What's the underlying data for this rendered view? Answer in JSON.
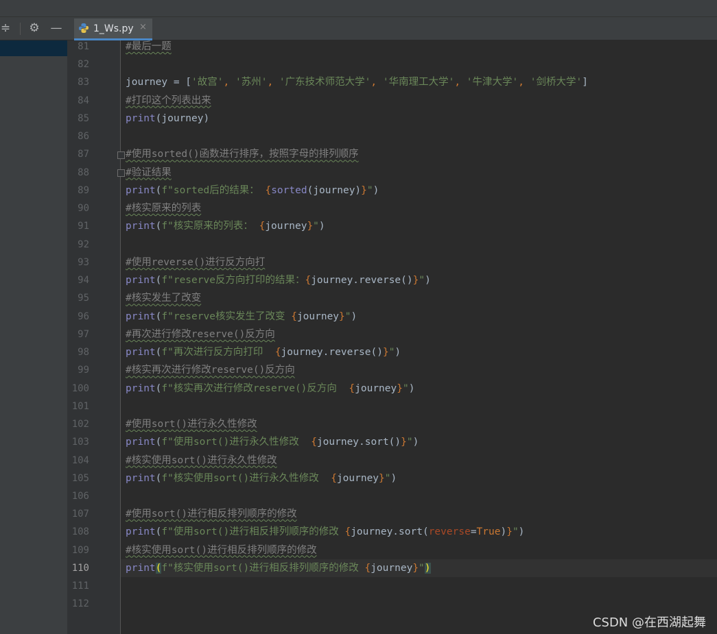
{
  "tab": {
    "label": "1_Ws.py",
    "close": "×"
  },
  "toolbar": {
    "collapse_icon": "≑",
    "settings_icon": "⚙",
    "minimize_icon": "—"
  },
  "watermark": "CSDN @在西湖起舞",
  "lines": [
    {
      "num": "81",
      "tokens": [
        {
          "t": "#最后一题",
          "c": "cm"
        }
      ]
    },
    {
      "num": "82",
      "tokens": []
    },
    {
      "num": "83",
      "tokens": [
        {
          "t": "journey = [",
          "c": "plain"
        },
        {
          "t": "'故宫'",
          "c": "str"
        },
        {
          "t": ", ",
          "c": "brace"
        },
        {
          "t": "'苏州'",
          "c": "str"
        },
        {
          "t": ", ",
          "c": "brace"
        },
        {
          "t": "'广东技术师范大学'",
          "c": "str"
        },
        {
          "t": ", ",
          "c": "brace"
        },
        {
          "t": "'华南理工大学'",
          "c": "str"
        },
        {
          "t": ", ",
          "c": "brace"
        },
        {
          "t": "'牛津大学'",
          "c": "str"
        },
        {
          "t": ", ",
          "c": "brace"
        },
        {
          "t": "'剑桥大学'",
          "c": "str"
        },
        {
          "t": "]",
          "c": "plain"
        }
      ]
    },
    {
      "num": "84",
      "tokens": [
        {
          "t": "#打印这个列表出来",
          "c": "cm"
        }
      ]
    },
    {
      "num": "85",
      "tokens": [
        {
          "t": "print",
          "c": "kw"
        },
        {
          "t": "(journey)",
          "c": "plain"
        }
      ]
    },
    {
      "num": "86",
      "tokens": []
    },
    {
      "num": "87",
      "tokens": [
        {
          "t": "#使用sorted()函数进行排序，按照字母的排列顺序",
          "c": "cm"
        }
      ]
    },
    {
      "num": "88",
      "tokens": [
        {
          "t": "#验证结果",
          "c": "cm"
        }
      ]
    },
    {
      "num": "89",
      "tokens": [
        {
          "t": "print",
          "c": "kw"
        },
        {
          "t": "(",
          "c": "plain"
        },
        {
          "t": "f\"sorted后的结果： ",
          "c": "str"
        },
        {
          "t": "{",
          "c": "brace"
        },
        {
          "t": "sorted",
          "c": "kw"
        },
        {
          "t": "(journey)",
          "c": "plain"
        },
        {
          "t": "}",
          "c": "brace"
        },
        {
          "t": "\"",
          "c": "str"
        },
        {
          "t": ")",
          "c": "plain"
        }
      ]
    },
    {
      "num": "90",
      "tokens": [
        {
          "t": "#核实原来的列表",
          "c": "cm"
        }
      ]
    },
    {
      "num": "91",
      "tokens": [
        {
          "t": "print",
          "c": "kw"
        },
        {
          "t": "(",
          "c": "plain"
        },
        {
          "t": "f\"核实原来的列表： ",
          "c": "str"
        },
        {
          "t": "{",
          "c": "brace"
        },
        {
          "t": "journey",
          "c": "plain"
        },
        {
          "t": "}",
          "c": "brace"
        },
        {
          "t": "\"",
          "c": "str"
        },
        {
          "t": ")",
          "c": "plain"
        }
      ]
    },
    {
      "num": "92",
      "tokens": []
    },
    {
      "num": "93",
      "tokens": [
        {
          "t": "#使用reverse()进行反方向打",
          "c": "cm"
        }
      ]
    },
    {
      "num": "94",
      "tokens": [
        {
          "t": "print",
          "c": "kw"
        },
        {
          "t": "(",
          "c": "plain"
        },
        {
          "t": "f\"reserve反方向打印的结果：",
          "c": "str"
        },
        {
          "t": "{",
          "c": "brace"
        },
        {
          "t": "journey.reverse()",
          "c": "plain"
        },
        {
          "t": "}",
          "c": "brace"
        },
        {
          "t": "\"",
          "c": "str"
        },
        {
          "t": ")",
          "c": "plain"
        }
      ]
    },
    {
      "num": "95",
      "tokens": [
        {
          "t": "#核实发生了改变",
          "c": "cm"
        }
      ]
    },
    {
      "num": "96",
      "tokens": [
        {
          "t": "print",
          "c": "kw"
        },
        {
          "t": "(",
          "c": "plain"
        },
        {
          "t": "f\"reserve核实发生了改变 ",
          "c": "str"
        },
        {
          "t": "{",
          "c": "brace"
        },
        {
          "t": "journey",
          "c": "plain"
        },
        {
          "t": "}",
          "c": "brace"
        },
        {
          "t": "\"",
          "c": "str"
        },
        {
          "t": ")",
          "c": "plain"
        }
      ]
    },
    {
      "num": "97",
      "tokens": [
        {
          "t": "#再次进行修改reserve()反方向",
          "c": "cm"
        }
      ]
    },
    {
      "num": "98",
      "tokens": [
        {
          "t": "print",
          "c": "kw"
        },
        {
          "t": "(",
          "c": "plain"
        },
        {
          "t": "f\"再次进行反方向打印  ",
          "c": "str"
        },
        {
          "t": "{",
          "c": "brace"
        },
        {
          "t": "journey.reverse()",
          "c": "plain"
        },
        {
          "t": "}",
          "c": "brace"
        },
        {
          "t": "\"",
          "c": "str"
        },
        {
          "t": ")",
          "c": "plain"
        }
      ]
    },
    {
      "num": "99",
      "tokens": [
        {
          "t": "#核实再次进行修改reserve()反方向",
          "c": "cm"
        }
      ]
    },
    {
      "num": "100",
      "tokens": [
        {
          "t": "print",
          "c": "kw"
        },
        {
          "t": "(",
          "c": "plain"
        },
        {
          "t": "f\"核实再次进行修改reserve()反方向  ",
          "c": "str"
        },
        {
          "t": "{",
          "c": "brace"
        },
        {
          "t": "journey",
          "c": "plain"
        },
        {
          "t": "}",
          "c": "brace"
        },
        {
          "t": "\"",
          "c": "str"
        },
        {
          "t": ")",
          "c": "plain"
        }
      ]
    },
    {
      "num": "101",
      "tokens": []
    },
    {
      "num": "102",
      "tokens": [
        {
          "t": "#使用sort()进行永久性修改",
          "c": "cm"
        }
      ]
    },
    {
      "num": "103",
      "tokens": [
        {
          "t": "print",
          "c": "kw"
        },
        {
          "t": "(",
          "c": "plain"
        },
        {
          "t": "f\"使用sort()进行永久性修改  ",
          "c": "str"
        },
        {
          "t": "{",
          "c": "brace"
        },
        {
          "t": "journey.sort()",
          "c": "plain"
        },
        {
          "t": "}",
          "c": "brace"
        },
        {
          "t": "\"",
          "c": "str"
        },
        {
          "t": ")",
          "c": "plain"
        }
      ]
    },
    {
      "num": "104",
      "tokens": [
        {
          "t": "#核实使用sort()进行永久性修改",
          "c": "cm"
        }
      ]
    },
    {
      "num": "105",
      "tokens": [
        {
          "t": "print",
          "c": "kw"
        },
        {
          "t": "(",
          "c": "plain"
        },
        {
          "t": "f\"核实使用sort()进行永久性修改  ",
          "c": "str"
        },
        {
          "t": "{",
          "c": "brace"
        },
        {
          "t": "journey",
          "c": "plain"
        },
        {
          "t": "}",
          "c": "brace"
        },
        {
          "t": "\"",
          "c": "str"
        },
        {
          "t": ")",
          "c": "plain"
        }
      ]
    },
    {
      "num": "106",
      "tokens": []
    },
    {
      "num": "107",
      "tokens": [
        {
          "t": "#使用sort()进行相反排列顺序的修改",
          "c": "cm"
        }
      ]
    },
    {
      "num": "108",
      "tokens": [
        {
          "t": "print",
          "c": "kw"
        },
        {
          "t": "(",
          "c": "plain"
        },
        {
          "t": "f\"使用sort()进行相反排列顺序的修改 ",
          "c": "str"
        },
        {
          "t": "{",
          "c": "brace"
        },
        {
          "t": "journey.sort(",
          "c": "plain"
        },
        {
          "t": "reverse",
          "c": "kwarg"
        },
        {
          "t": "=",
          "c": "plain"
        },
        {
          "t": "True",
          "c": "bool"
        },
        {
          "t": ")",
          "c": "plain"
        },
        {
          "t": "}",
          "c": "brace"
        },
        {
          "t": "\"",
          "c": "str"
        },
        {
          "t": ")",
          "c": "plain"
        }
      ]
    },
    {
      "num": "109",
      "tokens": [
        {
          "t": "#核实使用sort()进行相反排列顺序的修改",
          "c": "cm"
        }
      ]
    },
    {
      "num": "110",
      "current": true,
      "tokens": [
        {
          "t": "print",
          "c": "kw"
        },
        {
          "t": "(",
          "c": "caret-hl"
        },
        {
          "t": "f\"核实使用sort()进行相反排列顺序的修改 ",
          "c": "str"
        },
        {
          "t": "{",
          "c": "brace"
        },
        {
          "t": "journey",
          "c": "plain"
        },
        {
          "t": "}",
          "c": "brace"
        },
        {
          "t": "\"",
          "c": "str"
        },
        {
          "t": ")",
          "c": "caret-hl"
        }
      ]
    },
    {
      "num": "111",
      "tokens": []
    },
    {
      "num": "112",
      "tokens": []
    }
  ]
}
